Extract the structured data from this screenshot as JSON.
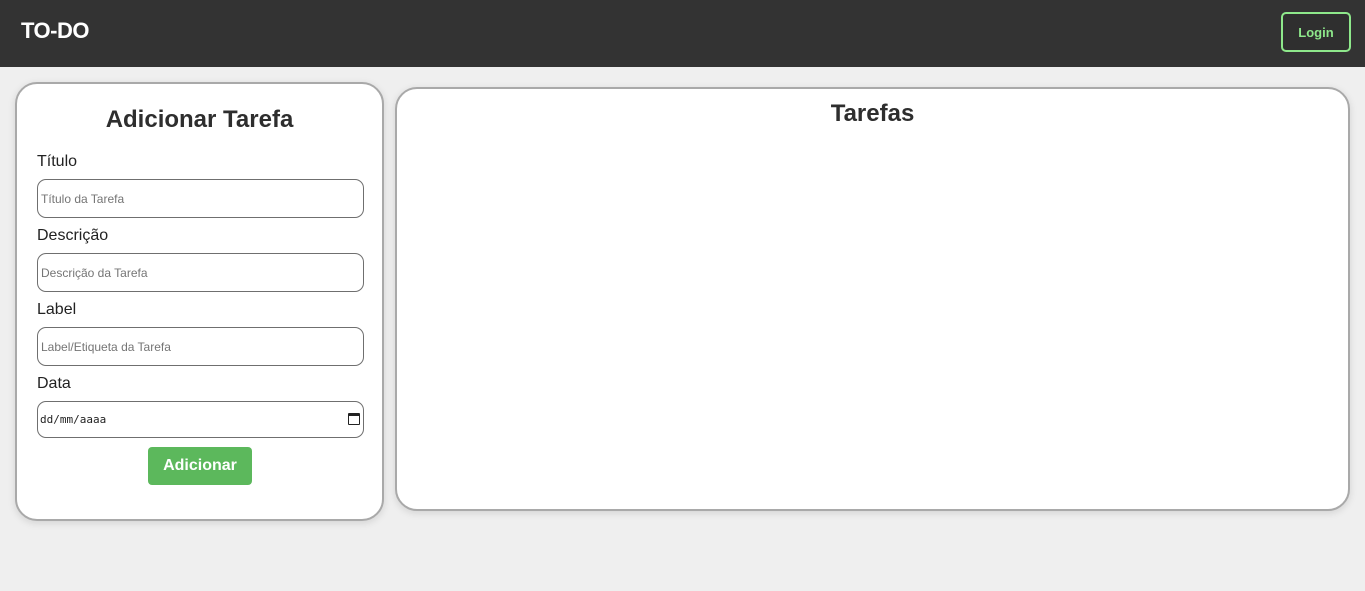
{
  "header": {
    "brand": "TO-DO",
    "login_label": "Login"
  },
  "form": {
    "title": "Adicionar Tarefa",
    "titulo_label": "Título",
    "titulo_placeholder": "Título da Tarefa",
    "descricao_label": "Descrição",
    "descricao_placeholder": "Descrição da Tarefa",
    "label_label": "Label",
    "label_placeholder": "Label/Etiqueta da Tarefa",
    "data_label": "Data",
    "data_value": "dd/mm/aaaa",
    "submit_label": "Adicionar"
  },
  "tasks": {
    "title": "Tarefas"
  },
  "colors": {
    "navbar": "#333333",
    "accent_green": "#5cb85c",
    "login_border": "#8ee88b"
  },
  "icons": {
    "date_picker": "calendar-icon"
  }
}
